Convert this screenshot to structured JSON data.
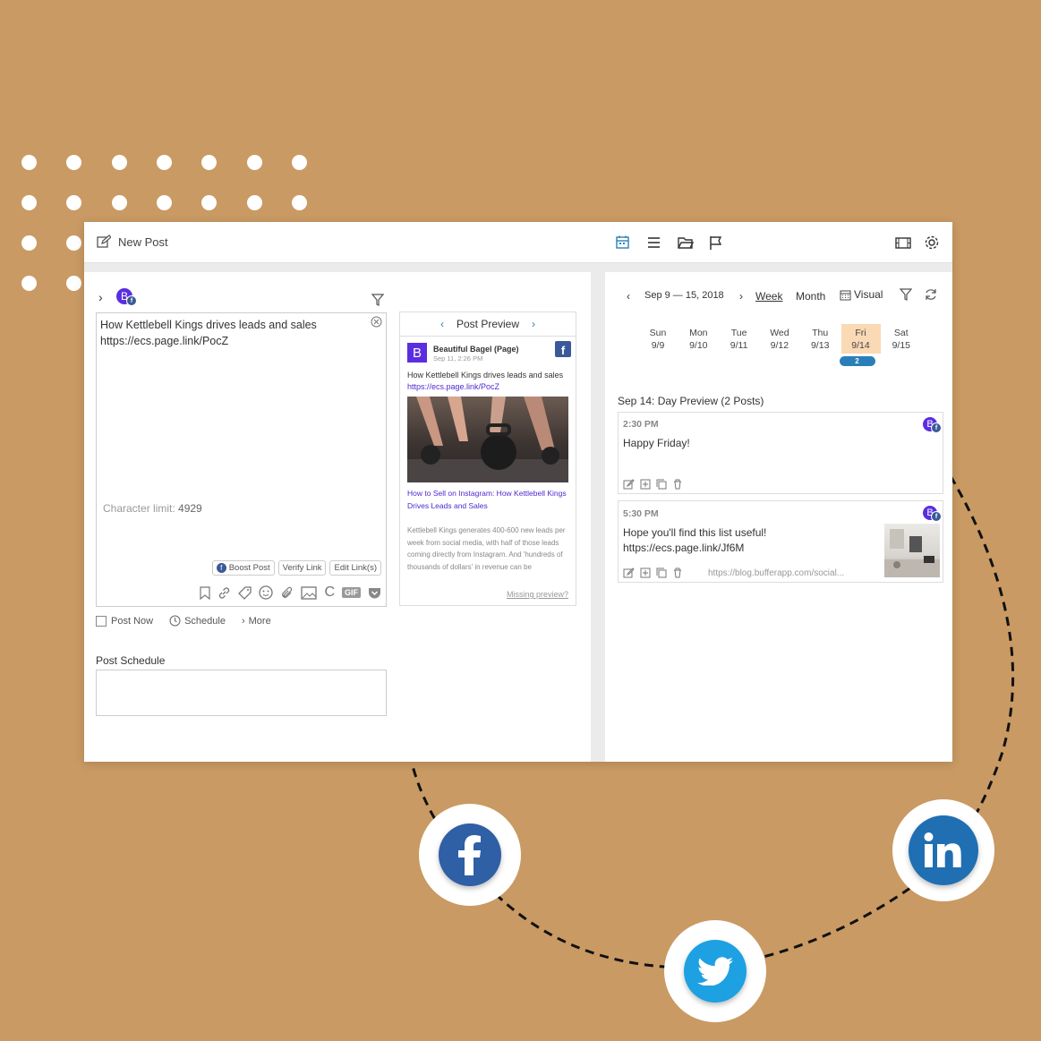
{
  "colors": {
    "background": "#c99a63",
    "accent": "#2a7fb8",
    "brand_purple": "#5a2ee0",
    "highlight_day": "#fad9b5",
    "facebook": "#3b5998",
    "twitter": "#1da1f2",
    "linkedin": "#0e76a8"
  },
  "toolbar": {
    "new_post": "New Post",
    "icons": [
      "calendar-icon",
      "list-icon",
      "folder-icon",
      "flag-icon",
      "film-icon",
      "gear-icon"
    ]
  },
  "composer": {
    "avatar_letter": "B",
    "text": "How Kettlebell Kings drives leads and sales https://ecs.page.link/PocZ",
    "char_limit_label": "Character limit:",
    "char_limit_value": "4929",
    "buttons": {
      "boost": "Boost Post",
      "verify": "Verify Link",
      "edit": "Edit Link(s)"
    },
    "gif": "GIF",
    "options": {
      "post_now": "Post Now",
      "schedule": "Schedule",
      "more": "More"
    },
    "schedule_label": "Post Schedule"
  },
  "preview": {
    "title": "Post Preview",
    "page_letter": "B",
    "page_name": "Beautiful Bagel (Page)",
    "date": "Sep 11, 2:26 PM",
    "text": "How Kettlebell Kings drives leads and sales",
    "link": "https://ecs.page.link/PocZ",
    "headline": "How to Sell on Instagram: How Kettlebell Kings Drives Leads and Sales",
    "description": "Kettlebell Kings generates 400-600 new leads per week from social media, with half of those leads coming directly from Instagram. And 'hundreds of thousands of dollars' in revenue can be",
    "missing": "Missing preview?"
  },
  "calendar": {
    "range": "Sep 9 — 15, 2018",
    "views": {
      "week": "Week",
      "month": "Month",
      "visual": "Visual"
    },
    "days": [
      {
        "name": "Sun",
        "date": "9/9"
      },
      {
        "name": "Mon",
        "date": "9/10"
      },
      {
        "name": "Tue",
        "date": "9/11"
      },
      {
        "name": "Wed",
        "date": "9/12"
      },
      {
        "name": "Thu",
        "date": "9/13"
      },
      {
        "name": "Fri",
        "date": "9/14"
      },
      {
        "name": "Sat",
        "date": "9/15"
      }
    ],
    "friday_count": "2",
    "day_preview_title": "Sep 14: Day Preview (2 Posts)",
    "posts": [
      {
        "time": "2:30 PM",
        "text": "Happy Friday!"
      },
      {
        "time": "5:30 PM",
        "text": "Hope you'll find this list useful! https://ecs.page.link/Jf6M",
        "link": "https://blog.bufferapp.com/social..."
      }
    ]
  },
  "social_icons": [
    "facebook-icon",
    "twitter-icon",
    "linkedin-icon"
  ]
}
